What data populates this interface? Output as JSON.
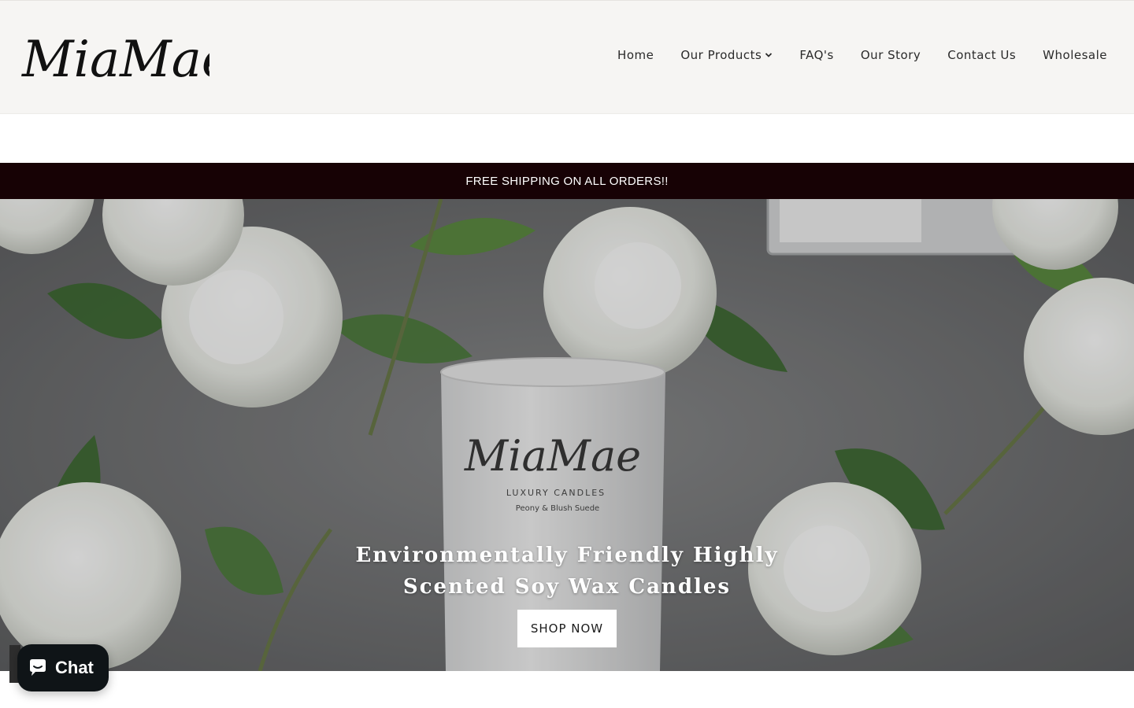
{
  "brand": {
    "logo_text": "MiaMae"
  },
  "nav": {
    "items": [
      {
        "label": "Home"
      },
      {
        "label": "Our Products",
        "has_dropdown": true
      },
      {
        "label": "FAQ's"
      },
      {
        "label": "Our Story"
      },
      {
        "label": "Contact Us"
      },
      {
        "label": "Wholesale"
      }
    ]
  },
  "announcement": {
    "text": "FREE SHIPPING ON ALL ORDERS!!"
  },
  "hero": {
    "headline_line1": "Environmentally Friendly Highly",
    "headline_line2": "Scented Soy Wax Candles",
    "cta_label": "SHOP NOW",
    "candle_logo": "MiaMae",
    "candle_subtitle": "LUXURY CANDLES",
    "candle_scent": "Peony & Blush Suede"
  },
  "chat": {
    "label": "Chat"
  },
  "colors": {
    "header_bg": "#f6f5f3",
    "announcement_bg": "#170205",
    "announcement_text": "#ffffff",
    "cta_bg": "#ffffff",
    "chat_bg": "#0f1417"
  }
}
